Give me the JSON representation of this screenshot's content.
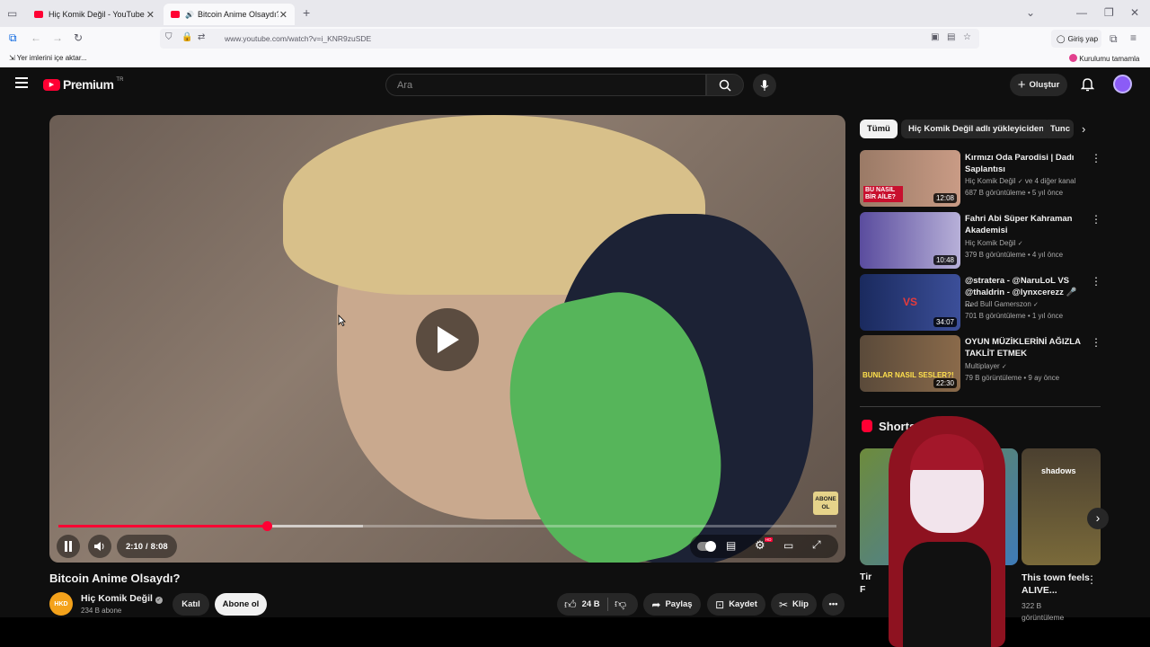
{
  "browser": {
    "tabs": [
      {
        "title": "Hiç Komik Değil - YouTube",
        "active": false
      },
      {
        "title": "Bitcoin Anime Olsaydı? - Yo",
        "active": true
      }
    ],
    "url": "www.youtube.com/watch?v=i_KNR9zuSDE",
    "signin_label": "Giriş yap",
    "bookmark_import_label": "Yer imlerini içe aktar...",
    "setup_label": "Kurulumu tamamla"
  },
  "header": {
    "logo_text": "Premium",
    "logo_badge": "TR",
    "search_placeholder": "Ara",
    "create_label": "Oluştur"
  },
  "player": {
    "time_current": "2:10",
    "time_separator": "/",
    "time_total": "8:08",
    "progress_fraction": 0.268,
    "buffer_fraction": 0.392,
    "subscribe_overlay": "ABONE OL"
  },
  "video": {
    "title": "Bitcoin Anime Olsaydı?",
    "channel_name": "Hiç Komik Değil",
    "channel_avatar_text": "HKD",
    "subscribers": "234 B abone",
    "join_label": "Katıl",
    "subscribe_label": "Abone ol",
    "like_count": "24 B",
    "share_label": "Paylaş",
    "save_label": "Kaydet",
    "clip_label": "Klip"
  },
  "chips": [
    "Tümü",
    "Hiç Komik Değil adlı yükleyiciden",
    "Tunc"
  ],
  "recommendations": [
    {
      "title": "Kırmızı Oda Parodisi | Dadı Saplantısı",
      "channel": "Hiç Komik Değil",
      "channel_extra": "ve 4 diğer kanal",
      "meta": "687 B görüntüleme • 5 yıl önce",
      "duration": "12:08",
      "thumb_text": "BU NASIL BİR AİLE?"
    },
    {
      "title": "Fahri Abi Süper Kahraman Akademisi",
      "channel": "Hiç Komik Değil",
      "channel_extra": "",
      "meta": "379 B görüntüleme • 4 yıl önce",
      "duration": "10:48",
      "thumb_text": ""
    },
    {
      "title": "@stratera - @NaruLoL VS @thaldrin - @lynxcerezz 🎤 ...",
      "channel": "Red Bull Gamerszon",
      "channel_extra": "",
      "meta": "701 B görüntüleme • 1 yıl önce",
      "duration": "34:07",
      "thumb_text": "VS"
    },
    {
      "title": "OYUN MÜZİKLERİNİ AĞIZLA TAKLİT ETMEK",
      "channel": "Multiplayer",
      "channel_extra": "",
      "meta": "79 B görüntüleme • 9 ay önce",
      "duration": "22:30",
      "thumb_text": "BUNLAR NASIL SESLER?!"
    }
  ],
  "shorts": {
    "heading": "Shorts",
    "items": [
      {
        "title_visible": "Tir",
        "title_line2": "F"
      },
      {
        "title_visible": "This town feels ALIVE...",
        "meta": "322 B görüntüleme",
        "thumb_text": "shadows"
      }
    ]
  },
  "colors": {
    "accent": "#ff0033",
    "progress": "#ff0033"
  }
}
